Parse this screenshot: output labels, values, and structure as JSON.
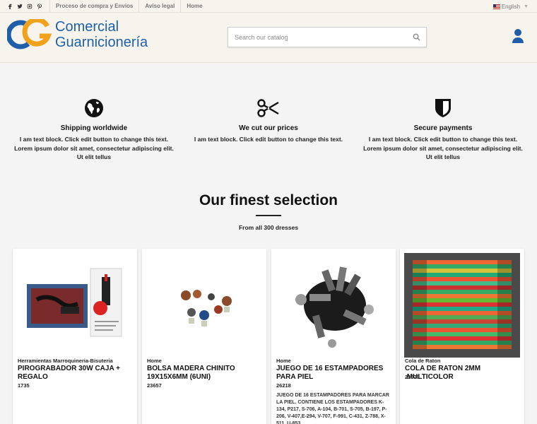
{
  "topbar": {
    "social": [
      "facebook-icon",
      "twitter-icon",
      "instagram-icon",
      "pinterest-icon"
    ],
    "links": [
      "Proceso de compra y Envios",
      "Aviso legal",
      "Home"
    ],
    "language": "English"
  },
  "header": {
    "logo_mark": "CG",
    "logo_line1": "Comercial",
    "logo_line2": "Guarnicionería",
    "search_placeholder": "Search our catalog",
    "colors": {
      "brand_blue": "#1f5fa8",
      "brand_orange": "#f0a21d"
    }
  },
  "features": [
    {
      "icon": "globe-icon",
      "title": "Shipping worldwide",
      "line1": "I am text block. Click edit button to change this text.",
      "line2": "Lorem ipsum dolor sit amet, consectetur adipiscing elit.",
      "line3": "Ut elit tellus"
    },
    {
      "icon": "scissors-icon",
      "title": "We cut our prices",
      "line1": "I am text block. Click edit button to change this text.",
      "line2": "",
      "line3": ""
    },
    {
      "icon": "shield-icon",
      "title": "Secure payments",
      "line1": "I am text block. Click edit button to change this text.",
      "line2": "Lorem ipsum dolor sit amet, consectetur adipiscing elit.",
      "line3": "Ut elit tellus"
    }
  ],
  "selection": {
    "title": "Our finest selection",
    "subtitle": "From all 300 dresses"
  },
  "products": [
    {
      "category": "Herramientas Marroquineria-Bisuteria",
      "name": "PIROGRABADOR 30W CAJA + REGALO",
      "reference": "1735",
      "description": ""
    },
    {
      "category": "Home",
      "name": "BOLSA MADERA CHINITO 19x15x6MM (6uni)",
      "reference": "23657",
      "description": ""
    },
    {
      "category": "Home",
      "name": "JUEGO DE 16 ESTAMPADORES PARA PIEL",
      "reference": "26218",
      "description": "JUEGO DE 16 ESTAMPADORES PARA MARCAR LA PIEL. CONTIENE LOS ESTAMPADORES K-134, P217, S-706, A-104, B-701, S-705, B-197, P-206, V-407,E-294, V-707, F-991, C-431, Z-788, X-511, U-853"
    },
    {
      "category": "Cola de Raton",
      "name": "COLA DE RATON 2mm .MULTICOLOR",
      "reference": "21079",
      "description": ""
    }
  ]
}
